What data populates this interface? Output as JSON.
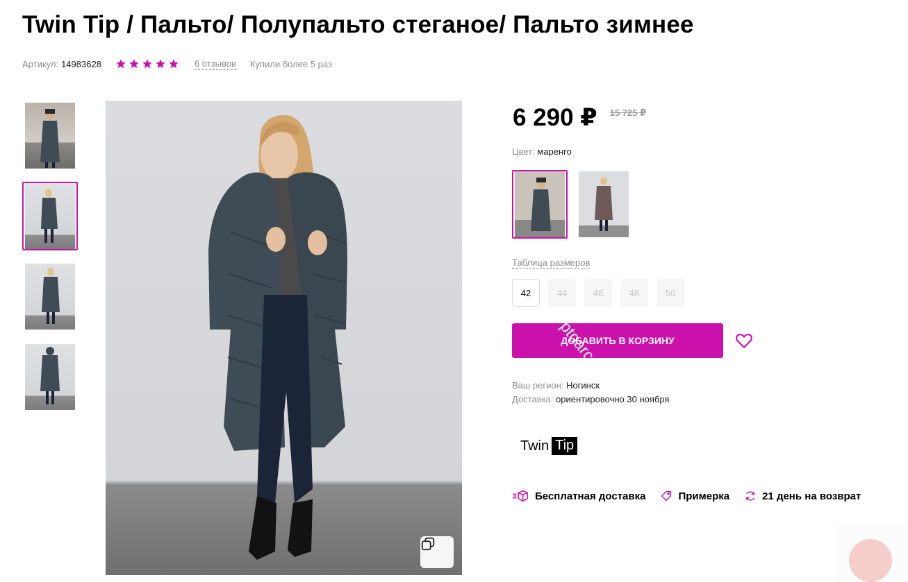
{
  "product": {
    "title": "Twin Tip / Пальто/ Полупальто стеганое/ Пальто зимнее",
    "article_label": "Артикул:",
    "article_value": "14983628",
    "rating_stars": 5,
    "reviews_label": "6 отзывов",
    "bought_label": "Купили более 5 раз"
  },
  "price": {
    "current": "6 290 ₽",
    "old": "15 725 ₽"
  },
  "color": {
    "label": "Цвет:",
    "value": "маренго",
    "swatches": [
      {
        "name": "маренго",
        "selected": true,
        "coat_color": "#3f4b55"
      },
      {
        "name": "мокко",
        "selected": false,
        "coat_color": "#6e5a58"
      }
    ]
  },
  "sizes": {
    "table_label": "Таблица размеров",
    "items": [
      {
        "label": "42",
        "available": true
      },
      {
        "label": "44",
        "available": false
      },
      {
        "label": "46",
        "available": false
      },
      {
        "label": "48",
        "available": false
      },
      {
        "label": "50",
        "available": false
      }
    ]
  },
  "cart": {
    "button_label": "Добавить в корзину",
    "watermark": "ptoarc"
  },
  "delivery": {
    "region_label": "Ваш регион:",
    "region_value": "Ногинск",
    "delivery_label": "Доставка:",
    "delivery_value": "ориентировочно 30 ноября"
  },
  "brand": {
    "word1": "Twin",
    "word2": "Tip"
  },
  "features": [
    {
      "icon": "box-delivery-icon",
      "label": "Бесплатная доставка"
    },
    {
      "icon": "tag-icon",
      "label": "Примерка"
    },
    {
      "icon": "refresh-icon",
      "label": "21 день на возврат"
    }
  ],
  "colors": {
    "accent": "#cb11ab",
    "muted_text": "#8b8b8b"
  }
}
